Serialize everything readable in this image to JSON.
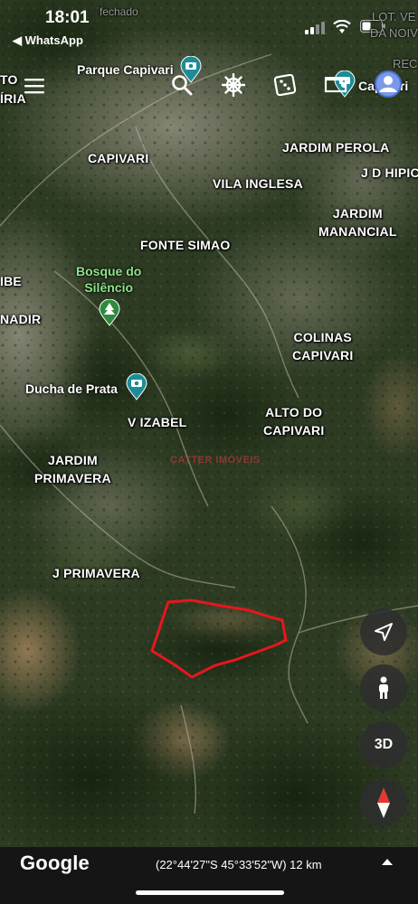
{
  "status": {
    "time": "18:01",
    "back_label": "◀ WhatsApp"
  },
  "map": {
    "faint_labels": [
      {
        "name": "fechado"
      },
      {
        "name": "LOT. VE"
      },
      {
        "name": "DA NOIV"
      },
      {
        "name": "REC"
      },
      {
        "name": "TO"
      },
      {
        "name": "ÍRIA"
      },
      {
        "name": "IBE"
      },
      {
        "name": "NADIR"
      }
    ],
    "places": [
      {
        "name": "CAPIVARI"
      },
      {
        "name": "JARDIM PEROLA"
      },
      {
        "name": "J D HIPIC"
      },
      {
        "name": "VILA INGLESA"
      },
      {
        "name": "JARDIM",
        "name2": "MANANCIAL"
      },
      {
        "name": "FONTE SIMAO"
      },
      {
        "name": "COLINAS",
        "name2": "CAPIVARI"
      },
      {
        "name": "V IZABEL"
      },
      {
        "name": "ALTO DO",
        "name2": "CAPIVARI"
      },
      {
        "name": "JARDIM",
        "name2": "PRIMAVERA"
      },
      {
        "name": "J PRIMAVERA"
      }
    ],
    "pois": [
      {
        "name": "Parque Capivari",
        "icon": "camera-pin-icon"
      },
      {
        "name": "Capivari",
        "icon": "camera-pin-icon"
      },
      {
        "name": "Bosque do",
        "name2": "Silêncio",
        "icon": "tree-pin-icon"
      },
      {
        "name": "Ducha de Prata",
        "icon": "camera-pin-icon"
      }
    ],
    "watermark": "CATTER IMÓVEIS",
    "boundary_color": "#e8161c"
  },
  "footer": {
    "brand": "Google",
    "coordinates": "(22°44'27\"S 45°33'52\"W) 12 km"
  },
  "controls": {
    "three_d_label": "3D"
  },
  "colors": {
    "terrain_dark": "#1f2f1a",
    "terrain_mid": "#3b4a2c",
    "urban": "#8a8b78",
    "bare": "#9a8060",
    "poi_teal": "#1e8c96",
    "poi_green": "#2e8b3e"
  }
}
